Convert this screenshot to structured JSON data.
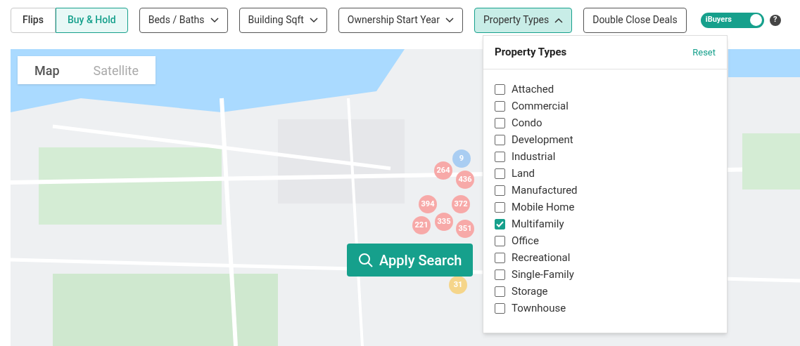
{
  "toolbar": {
    "segments": [
      {
        "label": "Flips",
        "selected": false
      },
      {
        "label": "Buy & Hold",
        "selected": true
      }
    ],
    "filters": [
      {
        "label": "Beds / Baths",
        "kind": "dropdown",
        "expanded": false
      },
      {
        "label": "Building Sqft",
        "kind": "dropdown",
        "expanded": false
      },
      {
        "label": "Ownership Start Year",
        "kind": "dropdown",
        "expanded": false
      },
      {
        "label": "Property Types",
        "kind": "dropdown",
        "expanded": true
      },
      {
        "label": "Double Close Deals",
        "kind": "button",
        "expanded": false
      }
    ],
    "toggle": {
      "label": "iBuyers",
      "on": true
    },
    "help": "?"
  },
  "map": {
    "view_tabs": [
      {
        "label": "Map",
        "selected": true
      },
      {
        "label": "Satellite",
        "selected": false
      }
    ],
    "markers": [
      {
        "label": "9",
        "color": "#a9cdf2"
      },
      {
        "label": "264",
        "color": "#f7a9a8"
      },
      {
        "label": "436",
        "color": "#f7a9a8"
      },
      {
        "label": "394",
        "color": "#f7a9a8"
      },
      {
        "label": "372",
        "color": "#f7a9a8"
      },
      {
        "label": "221",
        "color": "#f7a9a8"
      },
      {
        "label": "335",
        "color": "#f7a9a8"
      },
      {
        "label": "351",
        "color": "#f7a9a8"
      },
      {
        "label": "31",
        "color": "#f5d58a"
      }
    ],
    "apply_button": "Apply Search"
  },
  "dropdown": {
    "title": "Property Types",
    "reset": "Reset",
    "options": [
      {
        "label": "Attached",
        "checked": false
      },
      {
        "label": "Commercial",
        "checked": false
      },
      {
        "label": "Condo",
        "checked": false
      },
      {
        "label": "Development",
        "checked": false
      },
      {
        "label": "Industrial",
        "checked": false
      },
      {
        "label": "Land",
        "checked": false
      },
      {
        "label": "Manufactured",
        "checked": false
      },
      {
        "label": "Mobile Home",
        "checked": false
      },
      {
        "label": "Multifamily",
        "checked": true
      },
      {
        "label": "Office",
        "checked": false
      },
      {
        "label": "Recreational",
        "checked": false
      },
      {
        "label": "Single-Family",
        "checked": false
      },
      {
        "label": "Storage",
        "checked": false
      },
      {
        "label": "Townhouse",
        "checked": false
      }
    ]
  }
}
